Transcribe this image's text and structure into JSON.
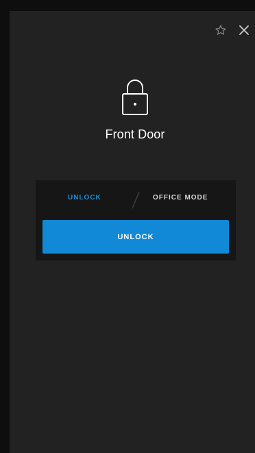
{
  "header": {
    "favorite_icon": "star-outline-icon",
    "close_icon": "close-icon"
  },
  "door": {
    "icon": "lock-icon",
    "name": "Front Door"
  },
  "mode_tabs": {
    "active": "UNLOCK",
    "items": [
      {
        "label": "UNLOCK",
        "active": true
      },
      {
        "label": "OFFICE MODE",
        "active": false
      }
    ]
  },
  "action": {
    "unlock_label": "UNLOCK"
  },
  "colors": {
    "accent": "#1189d6",
    "active_tab": "#1a8fd8",
    "panel_bg": "#222222",
    "card_bg": "#161616"
  }
}
